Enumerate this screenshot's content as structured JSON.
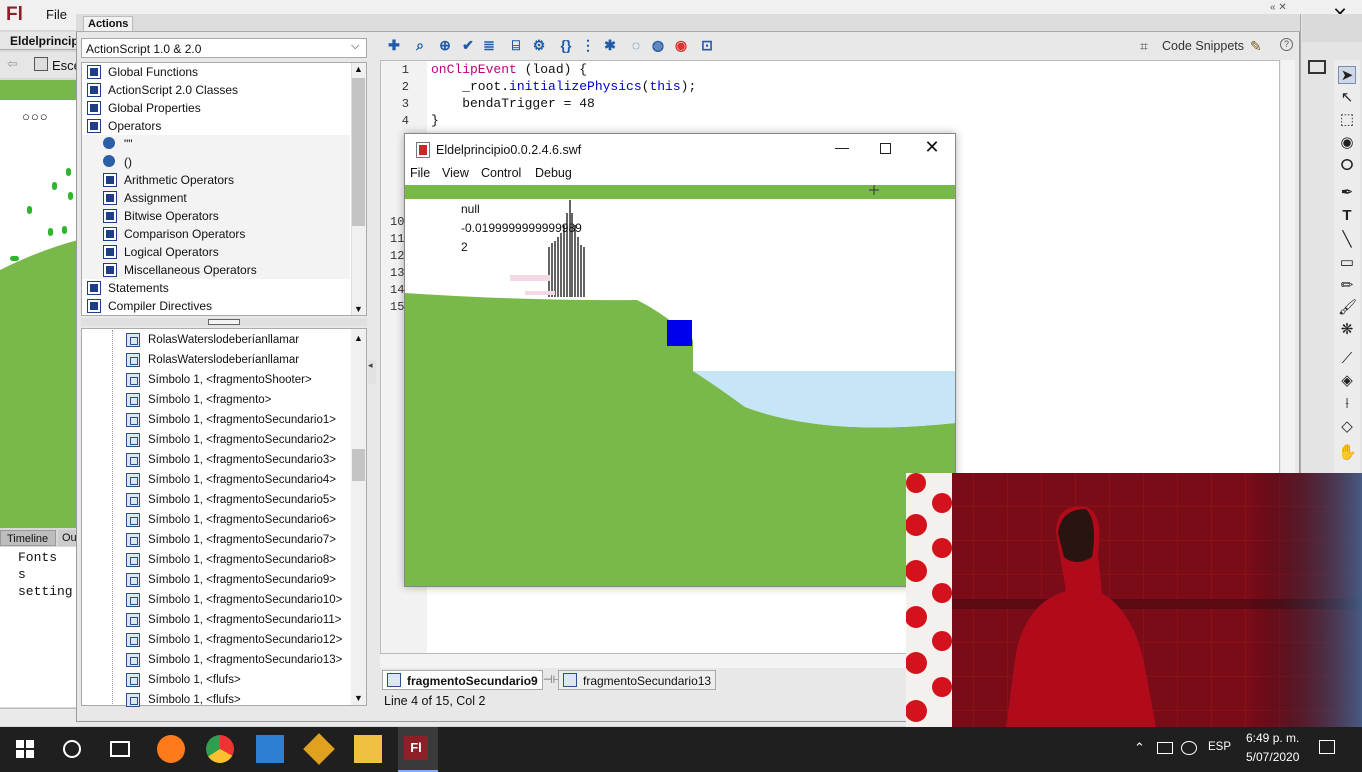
{
  "app": {
    "logo": "Fl",
    "file_menu": "File",
    "document_tab": "Eldelprincipi",
    "scene_label": "Esce",
    "timeline_tab": "Timeline",
    "output_tab": "Ou",
    "output_lines": [
      "Fonts s",
      "setting"
    ],
    "close_glyph": "✕"
  },
  "actions_panel": {
    "title": "Actions",
    "version_select": "ActionScript 1.0 & 2.0",
    "library": [
      {
        "label": "Global Functions",
        "icon": "book-icon",
        "indent": 0
      },
      {
        "label": "ActionScript 2.0 Classes",
        "icon": "book-icon",
        "indent": 0
      },
      {
        "label": "Global Properties",
        "icon": "book-icon",
        "indent": 0
      },
      {
        "label": "Operators",
        "icon": "open-book-icon",
        "indent": 0
      },
      {
        "label": "\"\"",
        "icon": "circle-icon",
        "indent": 1
      },
      {
        "label": "()",
        "icon": "circle-icon",
        "indent": 1
      },
      {
        "label": "Arithmetic Operators",
        "icon": "book-icon",
        "indent": 1
      },
      {
        "label": "Assignment",
        "icon": "book-icon",
        "indent": 1
      },
      {
        "label": "Bitwise Operators",
        "icon": "book-icon",
        "indent": 1
      },
      {
        "label": "Comparison Operators",
        "icon": "book-icon",
        "indent": 1
      },
      {
        "label": "Logical Operators",
        "icon": "book-icon",
        "indent": 1
      },
      {
        "label": "Miscellaneous Operators",
        "icon": "book-icon",
        "indent": 1
      },
      {
        "label": "Statements",
        "icon": "book-icon",
        "indent": 0
      },
      {
        "label": "Compiler Directives",
        "icon": "book-icon",
        "indent": 0
      }
    ],
    "tree": [
      "RolasWaterslodeberíanllamar",
      "RolasWaterslodeberíanllamar",
      "Símbolo 1, <fragmentoShooter>",
      "Símbolo 1, <fragmento>",
      "Símbolo 1, <fragmentoSecundario1>",
      "Símbolo 1, <fragmentoSecundario2>",
      "Símbolo 1, <fragmentoSecundario3>",
      "Símbolo 1, <fragmentoSecundario4>",
      "Símbolo 1, <fragmentoSecundario5>",
      "Símbolo 1, <fragmentoSecundario6>",
      "Símbolo 1, <fragmentoSecundario7>",
      "Símbolo 1, <fragmentoSecundario8>",
      "Símbolo 1, <fragmentoSecundario9>",
      "Símbolo 1, <fragmentoSecundario10>",
      "Símbolo 1, <fragmentoSecundario11>",
      "Símbolo 1, <fragmentoSecundario12>",
      "Símbolo 1, <fragmentoSecundario13>",
      "Símbolo 1, <flufs>",
      "Símbolo 1, <flufs>"
    ],
    "code_snippets": "Code Snippets",
    "code_lines": [
      {
        "n": "1",
        "text": ""
      },
      {
        "n": "2",
        "text": ""
      },
      {
        "n": "3",
        "text": "    bendaTrigger = 48"
      },
      {
        "n": "4",
        "text": "}"
      }
    ],
    "code_line1_kw": "onClipEvent",
    "code_line1_rest": " (load) {",
    "code_line2_pre": "    _root.",
    "code_line2_fn": "initializePhysics",
    "code_line2_mid": "(",
    "code_line2_kw": "this",
    "code_line2_post": ");",
    "hidden_line_numbers": [
      "10",
      "11",
      "12",
      "13",
      "14",
      "15"
    ],
    "file_tabs": [
      "fragmentoSecundario9",
      "fragmentoSecundario13"
    ],
    "status": "Line 4 of 15, Col 2"
  },
  "swf_player": {
    "title": "Eldelprincipio0.0.2.4.6.swf",
    "menu": [
      "File",
      "View",
      "Control",
      "Debug"
    ],
    "readout": [
      "null",
      "-0.0199999999999989",
      "2"
    ]
  },
  "taskbar": {
    "language": "ESP",
    "time": "6:49 p. m.",
    "date": "5/07/2020"
  },
  "colors": {
    "grass": "#78b94a",
    "water": "#c6e6f8",
    "block": "#0000ee",
    "flash_red": "#8b2126"
  }
}
